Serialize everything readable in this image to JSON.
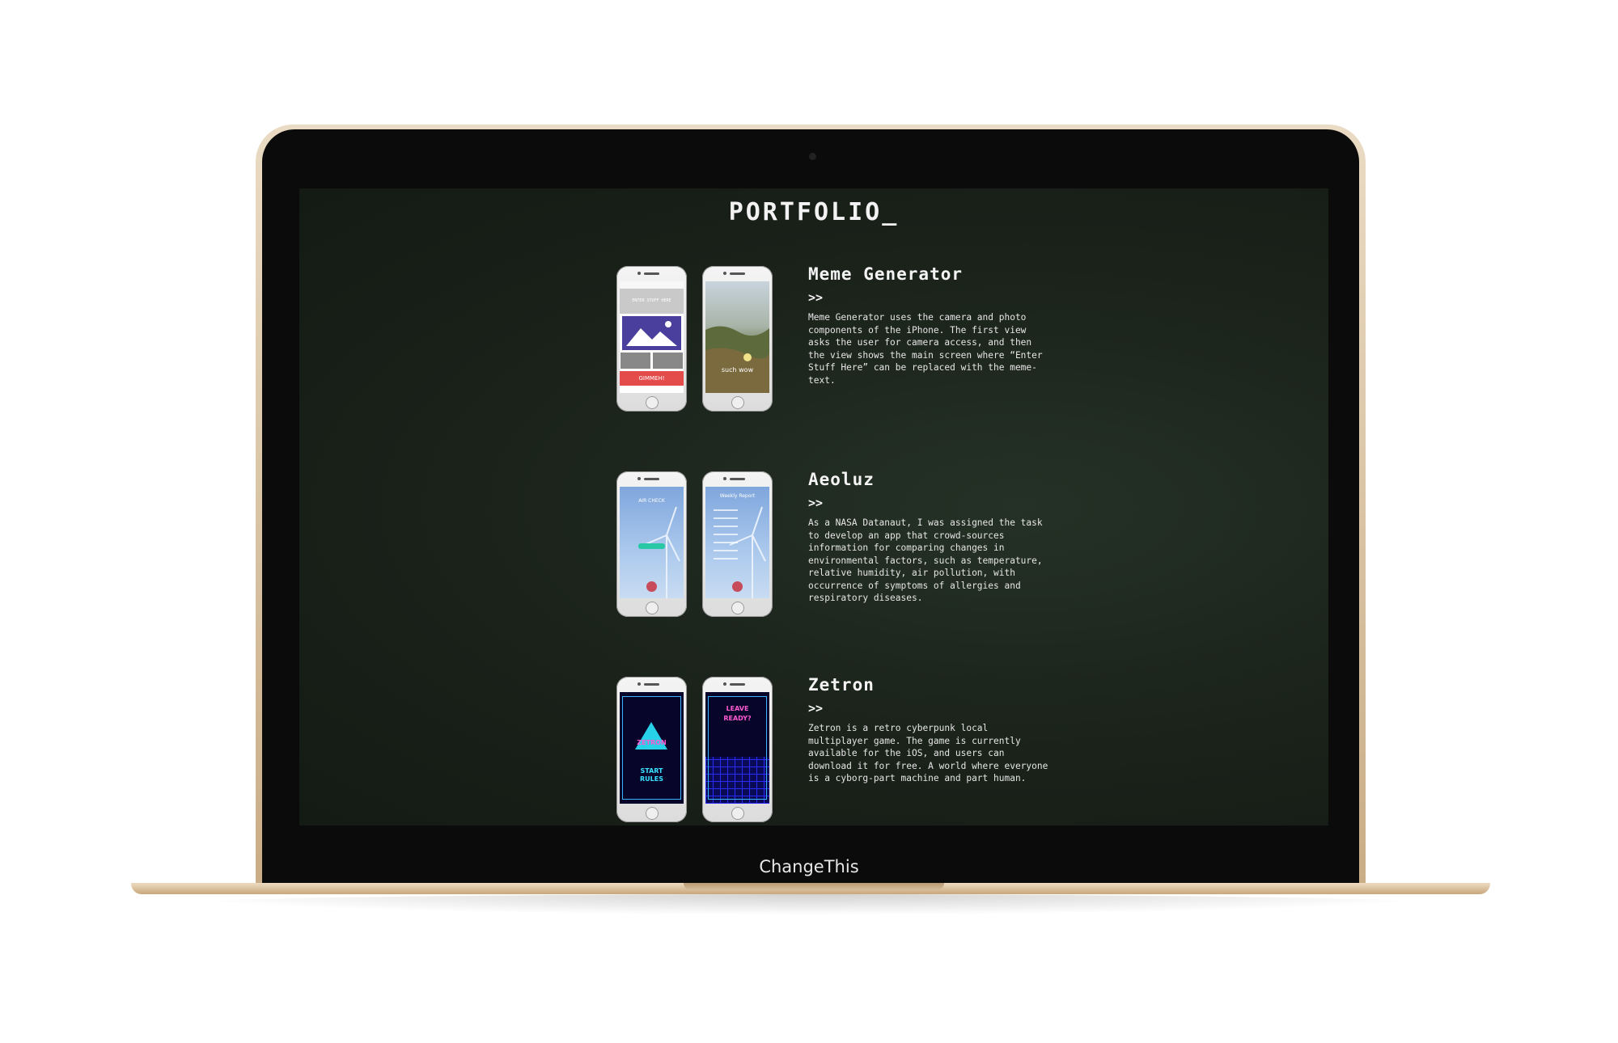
{
  "site": {
    "title": "PORTFOLIO_"
  },
  "device": {
    "label": "ChangeThis"
  },
  "projects": [
    {
      "title": "Meme Generator",
      "arrow": ">>",
      "description": "Meme Generator uses the camera and photo components of the iPhone. The first view asks the user for camera access, and then the view shows the main screen where “Enter Stuff Here” can be replaced with the meme-text.",
      "screens": {
        "top_text": "ENTER STUFF HERE",
        "button": "GIMMEH!",
        "caption": "such wow"
      }
    },
    {
      "title": "Aeoluz",
      "arrow": ">>",
      "description": "As a NASA Datanaut, I was assigned the task to develop an app that crowd-sources information for comparing changes in environmental factors, such as temperature, relative humidity, air pollution, with occurrence of symptoms of allergies and respiratory diseases.",
      "screens": {
        "screen1": "AIR CHECK",
        "screen2": "Weekly Report"
      }
    },
    {
      "title": "Zetron",
      "arrow": ">>",
      "description": "Zetron is a retro cyberpunk local multiplayer game. The game is currently available for the iOS, and users can download it for free. A world where everyone is a cyborg-part machine and part human.",
      "screens": {
        "logo": "ZETRON",
        "menu1": "START",
        "menu2": "RULES",
        "prompt1": "LEAVE",
        "prompt2": "READY?"
      }
    }
  ],
  "colors": {
    "screen_bg": "#1a221a",
    "text": "#f2f2f2",
    "laptop": "#d9c3a2"
  }
}
